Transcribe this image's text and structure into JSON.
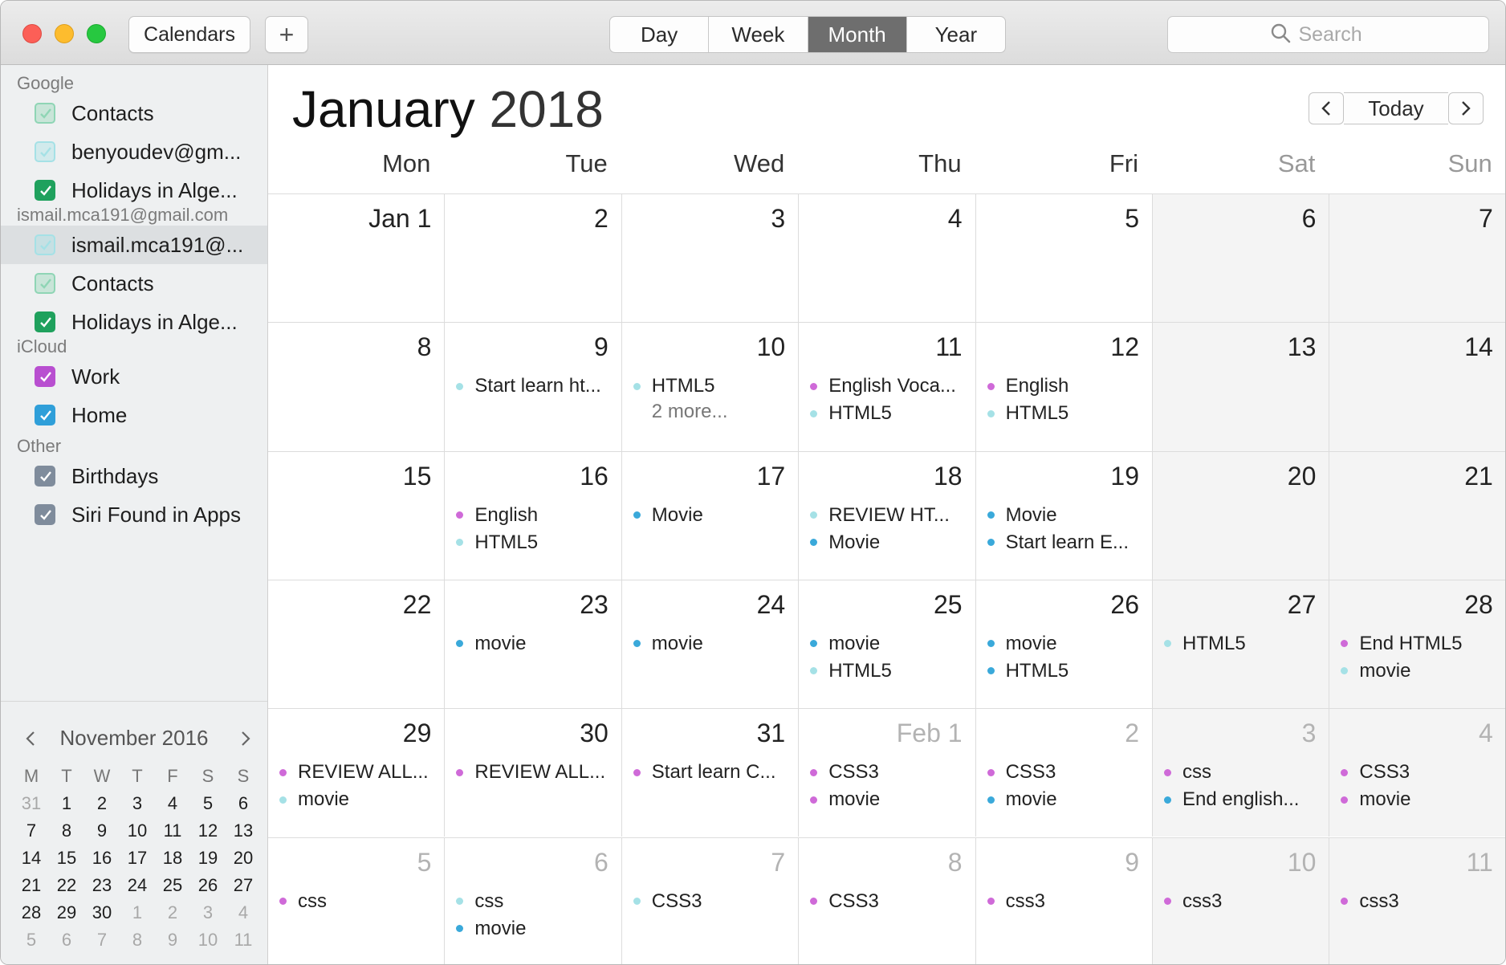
{
  "colors": {
    "purple": "#cf6ad8",
    "light_blue": "#a5e1e6",
    "blue": "#3aa9da",
    "green": "#1fa15d",
    "light_green": "#8fd5b5",
    "work_purple": "#b84fd0",
    "home_blue": "#2f9fd9",
    "gray_check": "#7f8c9c",
    "selected_segment": "#6e6e6e"
  },
  "toolbar": {
    "calendars_label": "Calendars",
    "add_label": "+",
    "views": [
      "Day",
      "Week",
      "Month",
      "Year"
    ],
    "active_view": "Month",
    "search_placeholder": "Search"
  },
  "sidebar": {
    "groups": [
      {
        "title": "Google",
        "items": [
          {
            "label": "Contacts",
            "color": "#8fd5b5",
            "checked": true
          },
          {
            "label": "benyoudev@gm...",
            "color": "#a5e1e6",
            "checked": true
          },
          {
            "label": "Holidays in Alge...",
            "color": "#1fa15d",
            "checked": true
          }
        ]
      },
      {
        "title": "ismail.mca191@gmail.com",
        "items": [
          {
            "label": "ismail.mca191@...",
            "color": "#a5e1e6",
            "checked": true,
            "selected": true
          },
          {
            "label": "Contacts",
            "color": "#8fd5b5",
            "checked": true
          },
          {
            "label": "Holidays in Alge...",
            "color": "#1fa15d",
            "checked": true
          }
        ]
      },
      {
        "title": "iCloud",
        "items": [
          {
            "label": "Work",
            "color": "#b84fd0",
            "checked": true
          },
          {
            "label": "Home",
            "color": "#2f9fd9",
            "checked": true
          }
        ]
      },
      {
        "title": "Other",
        "items": [
          {
            "label": "Birthdays",
            "color": "#7f8c9c",
            "checked": true
          },
          {
            "label": "Siri Found in Apps",
            "color": "#7f8c9c",
            "checked": true
          }
        ]
      }
    ]
  },
  "mini_calendar": {
    "title": "November 2016",
    "weekdays": [
      "M",
      "T",
      "W",
      "T",
      "F",
      "S",
      "S"
    ],
    "weeks": [
      [
        [
          "31",
          0
        ],
        [
          "1",
          1
        ],
        [
          "2",
          1
        ],
        [
          "3",
          1
        ],
        [
          "4",
          1
        ],
        [
          "5",
          1
        ],
        [
          "6",
          1
        ]
      ],
      [
        [
          "7",
          1
        ],
        [
          "8",
          1
        ],
        [
          "9",
          1
        ],
        [
          "10",
          1
        ],
        [
          "11",
          1
        ],
        [
          "12",
          1
        ],
        [
          "13",
          1
        ]
      ],
      [
        [
          "14",
          1
        ],
        [
          "15",
          1
        ],
        [
          "16",
          1
        ],
        [
          "17",
          1
        ],
        [
          "18",
          1
        ],
        [
          "19",
          1
        ],
        [
          "20",
          1
        ]
      ],
      [
        [
          "21",
          1
        ],
        [
          "22",
          1
        ],
        [
          "23",
          1
        ],
        [
          "24",
          1
        ],
        [
          "25",
          1
        ],
        [
          "26",
          1
        ],
        [
          "27",
          1
        ]
      ],
      [
        [
          "28",
          1
        ],
        [
          "29",
          1
        ],
        [
          "30",
          1
        ],
        [
          "1",
          0
        ],
        [
          "2",
          0
        ],
        [
          "3",
          0
        ],
        [
          "4",
          0
        ]
      ],
      [
        [
          "5",
          0
        ],
        [
          "6",
          0
        ],
        [
          "7",
          0
        ],
        [
          "8",
          0
        ],
        [
          "9",
          0
        ],
        [
          "10",
          0
        ],
        [
          "11",
          0
        ]
      ]
    ]
  },
  "month_view": {
    "month": "January",
    "year": "2018",
    "today_label": "Today",
    "weekdays": [
      "Mon",
      "Tue",
      "Wed",
      "Thu",
      "Fri",
      "Sat",
      "Sun"
    ],
    "weeks": [
      [
        {
          "day": "Jan 1",
          "in_month": true,
          "events": []
        },
        {
          "day": "2",
          "in_month": true,
          "events": []
        },
        {
          "day": "3",
          "in_month": true,
          "events": []
        },
        {
          "day": "4",
          "in_month": true,
          "events": []
        },
        {
          "day": "5",
          "in_month": true,
          "events": []
        },
        {
          "day": "6",
          "in_month": true,
          "events": []
        },
        {
          "day": "7",
          "in_month": true,
          "events": []
        }
      ],
      [
        {
          "day": "8",
          "in_month": true,
          "events": []
        },
        {
          "day": "9",
          "in_month": true,
          "events": [
            {
              "title": "Start learn ht...",
              "color": "#a5e1e6"
            }
          ]
        },
        {
          "day": "10",
          "in_month": true,
          "events": [
            {
              "title": "HTML5",
              "color": "#a5e1e6"
            }
          ],
          "more": "2 more..."
        },
        {
          "day": "11",
          "in_month": true,
          "events": [
            {
              "title": "English Voca...",
              "color": "#cf6ad8"
            },
            {
              "title": "HTML5",
              "color": "#a5e1e6"
            }
          ]
        },
        {
          "day": "12",
          "in_month": true,
          "events": [
            {
              "title": "English",
              "color": "#cf6ad8"
            },
            {
              "title": "HTML5",
              "color": "#a5e1e6"
            }
          ]
        },
        {
          "day": "13",
          "in_month": true,
          "events": []
        },
        {
          "day": "14",
          "in_month": true,
          "events": []
        }
      ],
      [
        {
          "day": "15",
          "in_month": true,
          "events": []
        },
        {
          "day": "16",
          "in_month": true,
          "events": [
            {
              "title": "English",
              "color": "#cf6ad8"
            },
            {
              "title": "HTML5",
              "color": "#a5e1e6"
            }
          ]
        },
        {
          "day": "17",
          "in_month": true,
          "events": [
            {
              "title": "Movie",
              "color": "#3aa9da"
            }
          ]
        },
        {
          "day": "18",
          "in_month": true,
          "events": [
            {
              "title": "REVIEW HT...",
              "color": "#a5e1e6"
            },
            {
              "title": "Movie",
              "color": "#3aa9da"
            }
          ]
        },
        {
          "day": "19",
          "in_month": true,
          "events": [
            {
              "title": "Movie",
              "color": "#3aa9da"
            },
            {
              "title": "Start learn E...",
              "color": "#3aa9da"
            }
          ]
        },
        {
          "day": "20",
          "in_month": true,
          "events": []
        },
        {
          "day": "21",
          "in_month": true,
          "events": []
        }
      ],
      [
        {
          "day": "22",
          "in_month": true,
          "events": []
        },
        {
          "day": "23",
          "in_month": true,
          "events": [
            {
              "title": "movie",
              "color": "#3aa9da"
            }
          ]
        },
        {
          "day": "24",
          "in_month": true,
          "events": [
            {
              "title": "movie",
              "color": "#3aa9da"
            }
          ]
        },
        {
          "day": "25",
          "in_month": true,
          "events": [
            {
              "title": "movie",
              "color": "#3aa9da"
            },
            {
              "title": "HTML5",
              "color": "#a5e1e6"
            }
          ]
        },
        {
          "day": "26",
          "in_month": true,
          "events": [
            {
              "title": "movie",
              "color": "#3aa9da"
            },
            {
              "title": "HTML5",
              "color": "#3aa9da"
            }
          ]
        },
        {
          "day": "27",
          "in_month": true,
          "events": [
            {
              "title": "HTML5",
              "color": "#a5e1e6"
            }
          ]
        },
        {
          "day": "28",
          "in_month": true,
          "events": [
            {
              "title": "End HTML5",
              "color": "#cf6ad8"
            },
            {
              "title": "movie",
              "color": "#a5e1e6"
            }
          ]
        }
      ],
      [
        {
          "day": "29",
          "in_month": true,
          "events": [
            {
              "title": "REVIEW ALL...",
              "color": "#cf6ad8"
            },
            {
              "title": "movie",
              "color": "#a5e1e6"
            }
          ]
        },
        {
          "day": "30",
          "in_month": true,
          "events": [
            {
              "title": "REVIEW ALL...",
              "color": "#cf6ad8"
            }
          ]
        },
        {
          "day": "31",
          "in_month": true,
          "events": [
            {
              "title": "Start learn C...",
              "color": "#cf6ad8"
            }
          ]
        },
        {
          "day": "Feb 1",
          "in_month": false,
          "events": [
            {
              "title": "CSS3",
              "color": "#cf6ad8"
            },
            {
              "title": "movie",
              "color": "#cf6ad8"
            }
          ]
        },
        {
          "day": "2",
          "in_month": false,
          "events": [
            {
              "title": "CSS3",
              "color": "#cf6ad8"
            },
            {
              "title": "movie",
              "color": "#3aa9da"
            }
          ]
        },
        {
          "day": "3",
          "in_month": false,
          "events": [
            {
              "title": "css",
              "color": "#cf6ad8"
            },
            {
              "title": "End english...",
              "color": "#3aa9da"
            }
          ]
        },
        {
          "day": "4",
          "in_month": false,
          "events": [
            {
              "title": "CSS3",
              "color": "#cf6ad8"
            },
            {
              "title": "movie",
              "color": "#cf6ad8"
            }
          ]
        }
      ],
      [
        {
          "day": "5",
          "in_month": false,
          "events": [
            {
              "title": "css",
              "color": "#cf6ad8"
            }
          ]
        },
        {
          "day": "6",
          "in_month": false,
          "events": [
            {
              "title": "css",
              "color": "#a5e1e6"
            },
            {
              "title": "movie",
              "color": "#3aa9da"
            }
          ]
        },
        {
          "day": "7",
          "in_month": false,
          "events": [
            {
              "title": "CSS3",
              "color": "#a5e1e6"
            }
          ]
        },
        {
          "day": "8",
          "in_month": false,
          "events": [
            {
              "title": "CSS3",
              "color": "#cf6ad8"
            }
          ]
        },
        {
          "day": "9",
          "in_month": false,
          "events": [
            {
              "title": "css3",
              "color": "#cf6ad8"
            }
          ]
        },
        {
          "day": "10",
          "in_month": false,
          "events": [
            {
              "title": "css3",
              "color": "#cf6ad8"
            }
          ]
        },
        {
          "day": "11",
          "in_month": false,
          "events": [
            {
              "title": "css3",
              "color": "#cf6ad8"
            }
          ]
        }
      ]
    ]
  }
}
